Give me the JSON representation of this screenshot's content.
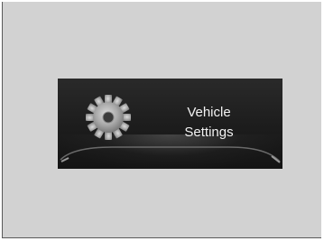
{
  "menu_item": {
    "label_line1": "Vehicle",
    "label_line2": "Settings",
    "icon": "gear-icon"
  }
}
